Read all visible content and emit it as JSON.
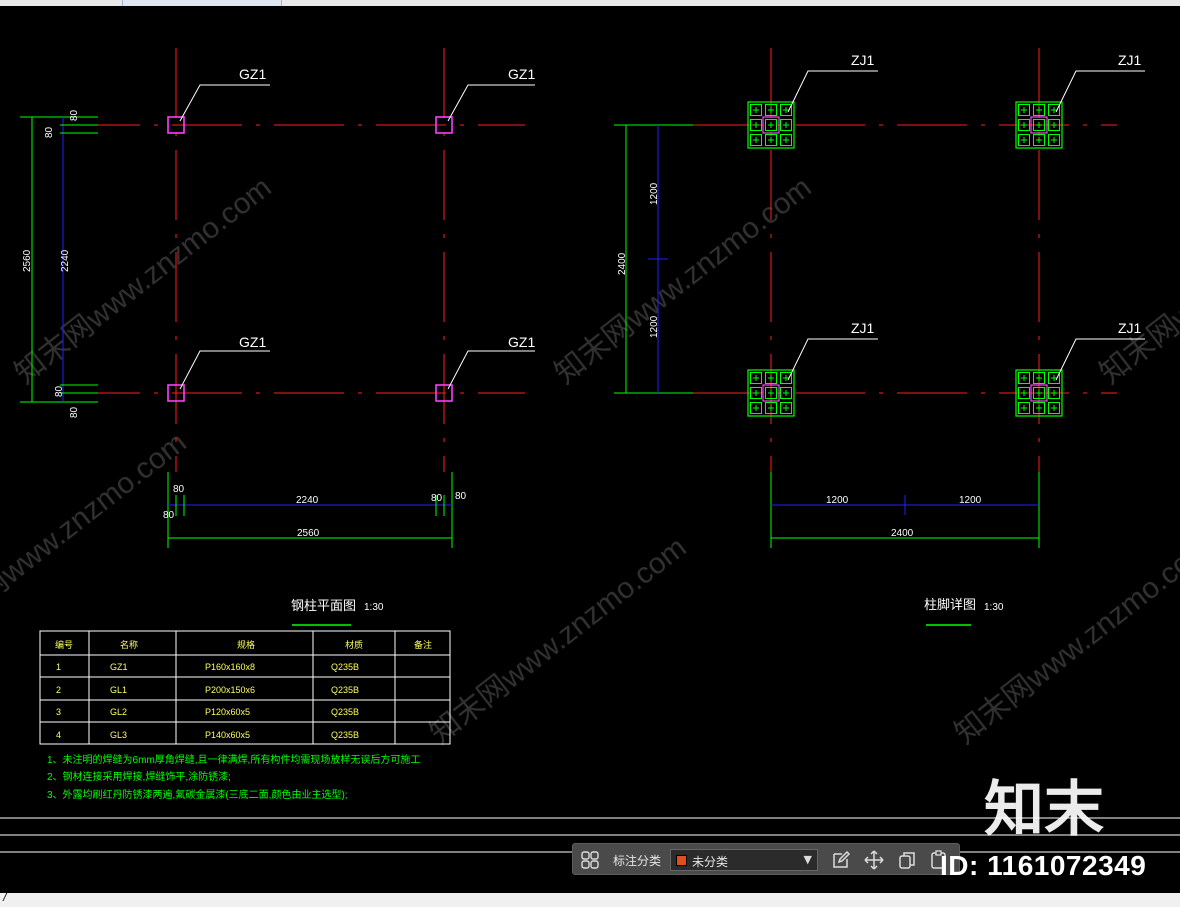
{
  "plan": {
    "column_label": "GZ1",
    "dims_left": {
      "total": "2560",
      "inner": "2240",
      "edge": "80"
    },
    "dims_bottom": {
      "inner": "2240",
      "total": "2560",
      "edge": "80"
    },
    "title": "钢柱平面图",
    "scale": "1:30"
  },
  "detail": {
    "footing_label": "ZJ1",
    "dims_left": {
      "total": "2400",
      "half": "1200"
    },
    "dims_bottom": {
      "half": "1200",
      "total": "2400"
    },
    "title": "柱脚详图",
    "scale": "1:30"
  },
  "table": {
    "headers": [
      "编号",
      "名称",
      "规格",
      "材质",
      "备注"
    ],
    "rows": [
      [
        "1",
        "GZ1",
        "P160x160x8",
        "Q235B",
        ""
      ],
      [
        "2",
        "GL1",
        "P200x150x6",
        "Q235B",
        ""
      ],
      [
        "3",
        "GL2",
        "P120x60x5",
        "Q235B",
        ""
      ],
      [
        "4",
        "GL3",
        "P140x60x5",
        "Q235B",
        ""
      ]
    ]
  },
  "notes": [
    "1、未注明的焊缝为6mm厚角焊缝,且一律满焊,所有构件均需现场放样无误后方可施工",
    "2、钢材连接采用焊接,焊缝饰平,涂防锈漆;",
    "3、外露均刷红丹防锈漆两遍,氟碳金属漆(三底二面,颜色由业主选型);"
  ],
  "watermark": "知末网www.znzmo.com",
  "brand": "知末",
  "id_text": "ID: 1161072349",
  "toolbar": {
    "label": "标注分类",
    "selected": "未分类",
    "swatch_color": "#e04e1c",
    "icons": [
      "grid-icon",
      "edit-icon",
      "move-icon",
      "copy-icon",
      "paste-icon"
    ]
  },
  "status_text": "/",
  "colors": {
    "axis": "#ff1e1e",
    "dimension": "#00ff00",
    "dim_line": "#2020ff",
    "column": "#ff3cff",
    "text": "#ffffff"
  }
}
